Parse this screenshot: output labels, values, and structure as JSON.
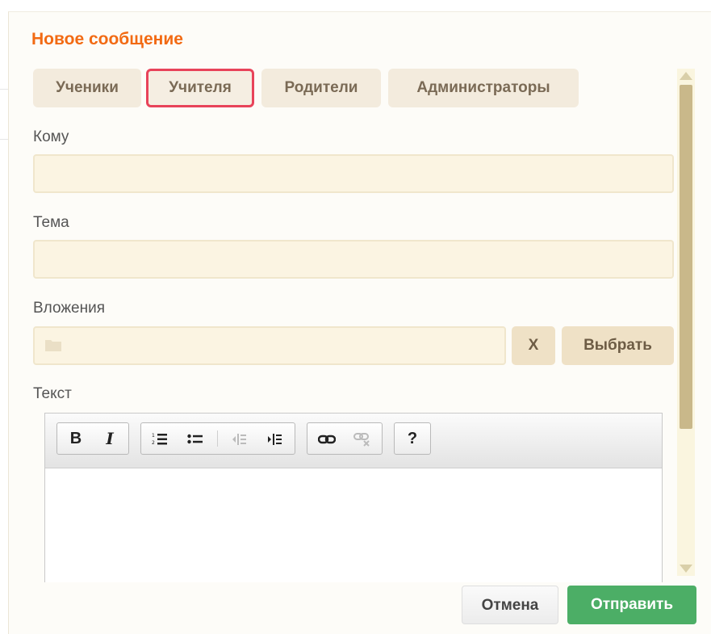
{
  "dialog": {
    "title": "Новое сообщение"
  },
  "tabs": [
    {
      "label": "Ученики",
      "selected": false
    },
    {
      "label": "Учителя",
      "selected": true
    },
    {
      "label": "Родители",
      "selected": false
    },
    {
      "label": "Администраторы",
      "selected": false
    }
  ],
  "form": {
    "to_label": "Кому",
    "to_value": "",
    "subject_label": "Тема",
    "subject_value": "",
    "attachments_label": "Вложения",
    "attachments_value": "",
    "clear_label": "X",
    "choose_label": "Выбрать",
    "text_label": "Текст"
  },
  "editor_toolbar": {
    "bold": "B",
    "italic": "I",
    "ordered_list": "ordered-list-icon",
    "unordered_list": "unordered-list-icon",
    "outdent": "outdent-icon",
    "indent": "indent-icon",
    "link": "link-icon",
    "unlink": "unlink-icon",
    "help": "?"
  },
  "footer": {
    "cancel_label": "Отмена",
    "send_label": "Отправить"
  },
  "colors": {
    "title": "#f26a13",
    "tab_bg": "#f3ebdd",
    "highlight": "#e8435a",
    "send": "#4cae66"
  }
}
